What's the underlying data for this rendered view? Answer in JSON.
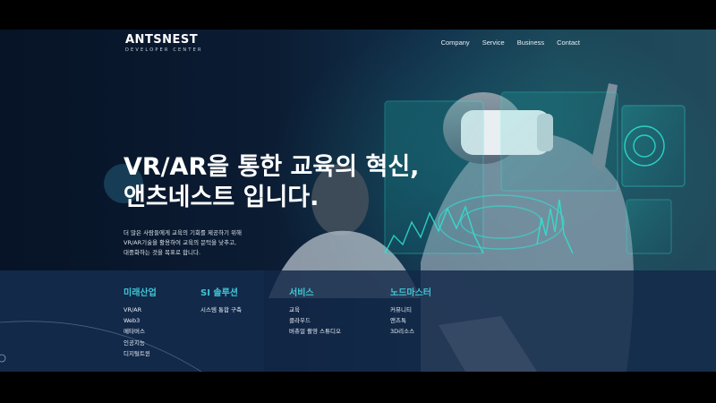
{
  "brand": {
    "name": "ANTSNEST",
    "tagline": "DEVELOPER CENTER"
  },
  "nav": {
    "items": [
      "Company",
      "Service",
      "Business",
      "Contact"
    ]
  },
  "hero": {
    "title_line1": "VR/AR을 통한 교육의 혁신,",
    "title_line2": "앤츠네스트 입니다.",
    "desc_line1": "더 많은 사람들에게 교육의 기회를 제공하기 위해",
    "desc_line2": "VR/AR기술을 활용하여 교육의 문턱을 낮추고,",
    "desc_line3": "대중화하는 것을 목표로 합니다."
  },
  "columns": [
    {
      "title": "미래산업",
      "items": [
        "VR/AR",
        "Web3",
        "메타버스",
        "인공지능",
        "디지털트윈"
      ]
    },
    {
      "title": "SI 솔루션",
      "items": [
        "시스템 통합 구축"
      ]
    },
    {
      "title": "서비스",
      "items": [
        "교육",
        "클라우드",
        "버츄얼 촬영 스튜디오"
      ]
    },
    {
      "title": "노드마스터",
      "items": [
        "커뮤니티",
        "앤츠톡",
        "3D리소스"
      ]
    }
  ],
  "colors": {
    "accent": "#3fc6d4",
    "background": "#0b1c33",
    "panel": "#122848"
  },
  "icons": [
    "hologram-graphic",
    "vr-headset-illustration"
  ]
}
